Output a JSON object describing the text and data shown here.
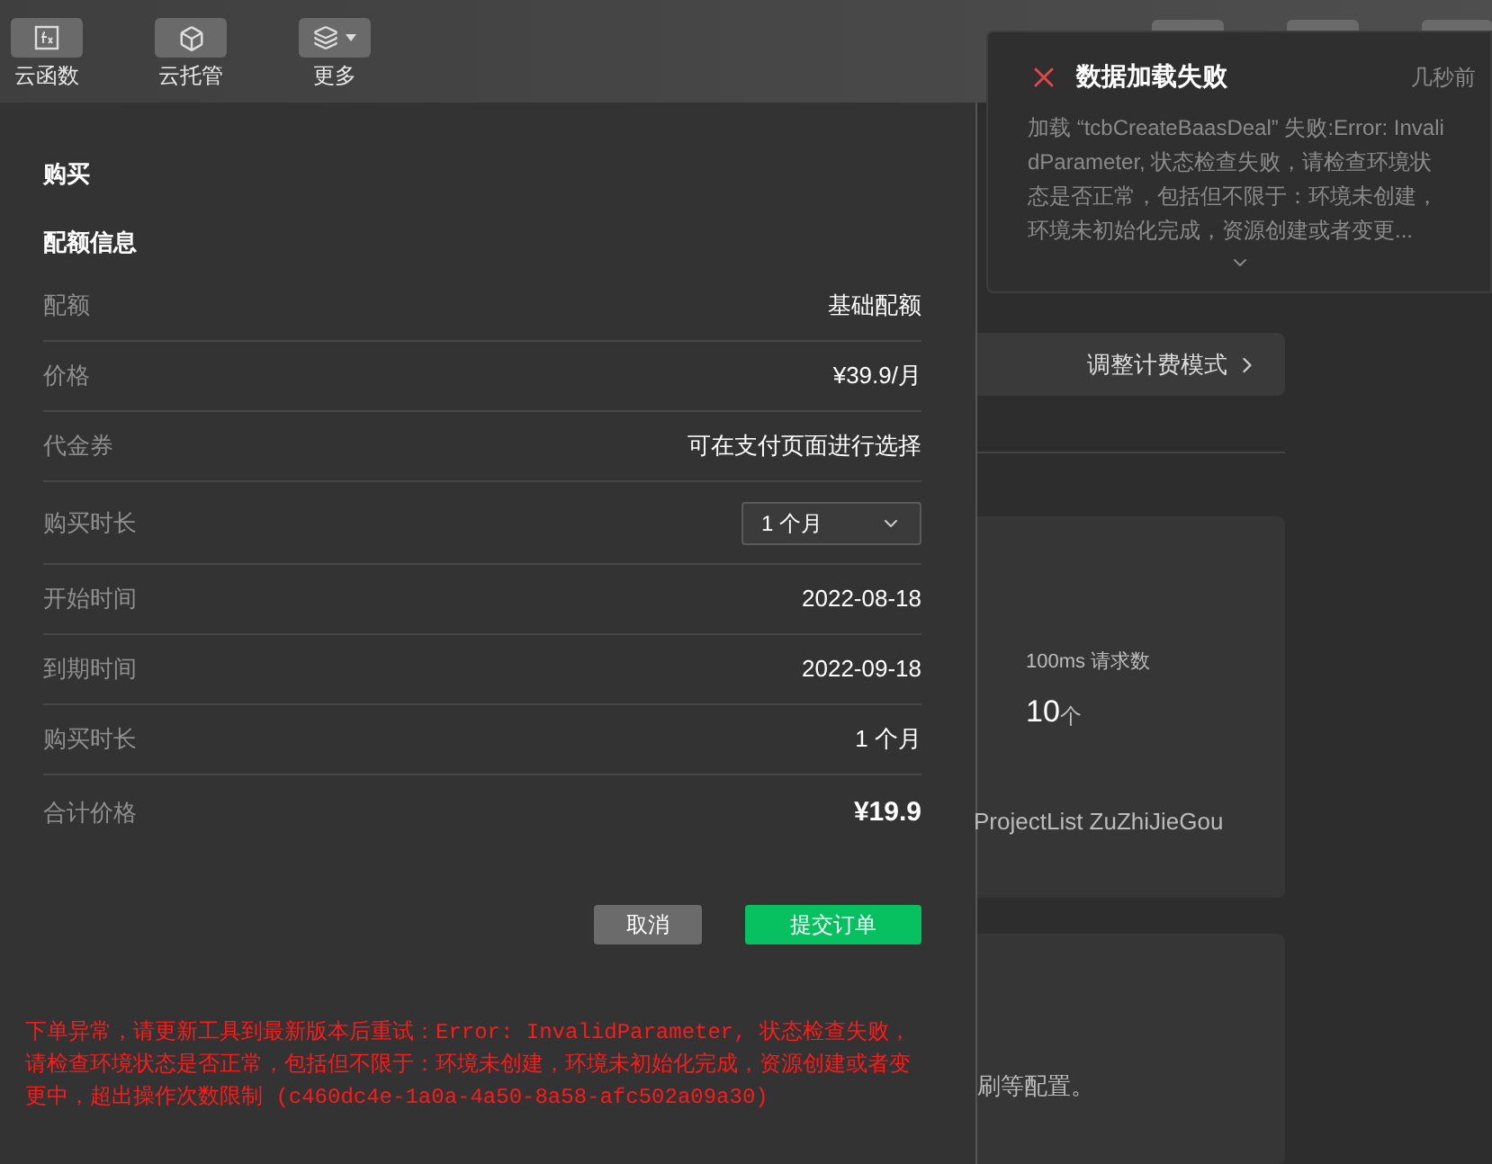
{
  "toolbar": {
    "items": [
      {
        "label": "云函数",
        "kind": "function"
      },
      {
        "label": "云托管",
        "kind": "cube"
      },
      {
        "label": "更多",
        "kind": "layers"
      }
    ]
  },
  "purchase_panel": {
    "title": "购买",
    "section_title": "配额信息",
    "rows": [
      {
        "label": "配额",
        "value": "基础配额",
        "kind": "text"
      },
      {
        "label": "价格",
        "value": "¥39.9/月",
        "kind": "text"
      },
      {
        "label": "代金券",
        "value": "可在支付页面进行选择",
        "kind": "text"
      },
      {
        "label": "购买时长",
        "value": "1 个月",
        "kind": "select"
      },
      {
        "label": "开始时间",
        "value": "2022-08-18",
        "kind": "text"
      },
      {
        "label": "到期时间",
        "value": "2022-09-18",
        "kind": "text"
      },
      {
        "label": "购买时长",
        "value": "1 个月",
        "kind": "text"
      },
      {
        "label": "合计价格",
        "value": "¥19.9",
        "kind": "total"
      }
    ],
    "buttons": [
      {
        "label": "取消",
        "kind": "secondary"
      },
      {
        "label": "提交订单",
        "kind": "primary"
      }
    ],
    "error": "下单异常，请更新工具到最新版本后重试：Error: InvalidParameter, 状态检查失败，请检查环境状态是否正常，包括但不限于：环境未创建，环境未初始化完成，资源创建或者变更中，超出操作次数限制 (c460dc4e-1a0a-4a50-8a58-afc502a09a30)"
  },
  "background": {
    "billing_button": "调整计费模式",
    "stat_label": "100ms 请求数",
    "stat_value": "10",
    "stat_unit": "个",
    "tags": "ProjectList ZuZhiJieGou",
    "note": "刷等配置。"
  },
  "notification": {
    "title": "数据加载失败",
    "time": "几秒前",
    "message": "加载 “tcbCreateBaasDeal” 失败:Error: InvalidParameter, 状态检查失败，请检查环境状态是否正常，包括但不限于：环境未创建，环境未初始化完成，资源创建或者变更..."
  }
}
